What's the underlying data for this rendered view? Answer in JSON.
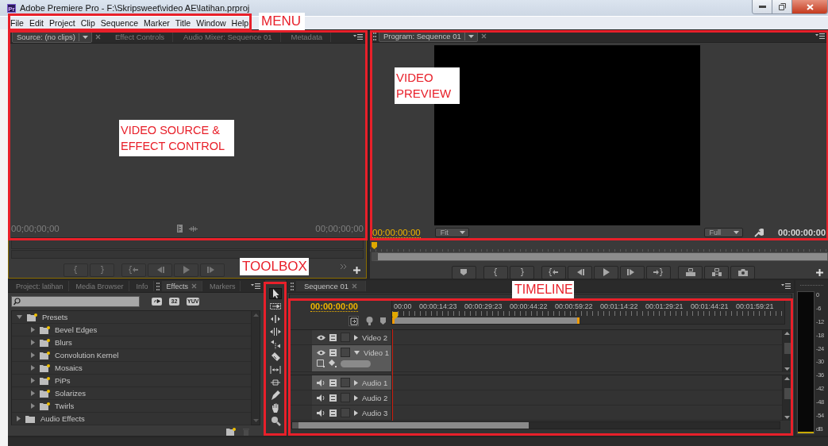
{
  "window": {
    "icon_text": "Pr",
    "title": "Adobe Premiere Pro - F:\\Skripsweet\\video AE\\latihan.prproj"
  },
  "menu": [
    "File",
    "Edit",
    "Project",
    "Clip",
    "Sequence",
    "Marker",
    "Title",
    "Window",
    "Help"
  ],
  "source_panel": {
    "tabs": [
      {
        "label": "Source: (no clips)",
        "selected": true
      },
      {
        "label": "Effect Controls",
        "selected": false
      },
      {
        "label": "Audio Mixer: Sequence 01",
        "selected": false
      },
      {
        "label": "Metadata",
        "selected": false
      }
    ],
    "timecode_left": "00;00;00;00",
    "timecode_right": "00;00;00;00"
  },
  "program_panel": {
    "tab": "Program: Sequence 01",
    "timecode": "00:00:00:00",
    "zoom": "Fit",
    "resolution": "Full",
    "duration": "00:00:00:00"
  },
  "project_panel": {
    "tabs": [
      {
        "label": "Project: latihan",
        "selected": false
      },
      {
        "label": "Media Browser",
        "selected": false
      },
      {
        "label": "Info",
        "selected": false
      },
      {
        "label": "Effects",
        "selected": true
      },
      {
        "label": "Markers",
        "selected": false
      }
    ],
    "filter_buttons": [
      "32",
      "YUV"
    ],
    "effects_tree": [
      {
        "label": "Presets",
        "kind": "preset",
        "expanded": true,
        "children": [
          {
            "label": "Bevel Edges",
            "kind": "preset",
            "expanded": false
          },
          {
            "label": "Blurs",
            "kind": "preset",
            "expanded": false
          },
          {
            "label": "Convolution Kernel",
            "kind": "preset",
            "expanded": false
          },
          {
            "label": "Mosaics",
            "kind": "preset",
            "expanded": false
          },
          {
            "label": "PiPs",
            "kind": "preset",
            "expanded": false
          },
          {
            "label": "Solarizes",
            "kind": "preset",
            "expanded": false
          },
          {
            "label": "Twirls",
            "kind": "preset",
            "expanded": false
          }
        ]
      },
      {
        "label": "Audio Effects",
        "kind": "folder",
        "expanded": false
      }
    ]
  },
  "toolbox": {
    "tools": [
      {
        "kind": "selection",
        "selected": true
      },
      {
        "kind": "track-select",
        "selected": false
      },
      {
        "kind": "ripple",
        "selected": false
      },
      {
        "kind": "rolling",
        "selected": false
      },
      {
        "kind": "rate-stretch",
        "selected": false
      },
      {
        "kind": "razor",
        "selected": false
      },
      {
        "kind": "slip",
        "selected": false
      },
      {
        "kind": "slide",
        "selected": false
      },
      {
        "kind": "pen",
        "selected": false
      },
      {
        "kind": "hand",
        "selected": false
      },
      {
        "kind": "zoom",
        "selected": false
      }
    ]
  },
  "timeline": {
    "tab": "Sequence 01",
    "timecode": "00:00:00:00",
    "ruler": [
      "00:00",
      "00:00:14:23",
      "00:00:29:23",
      "00:00:44:22",
      "00:00:59:22",
      "00:01:14:22",
      "00:01:29:21",
      "00:01:44:21",
      "00:01:59:21"
    ],
    "tracks": [
      {
        "name": "Video 2",
        "kind": "video",
        "expanded": false,
        "targeted": false
      },
      {
        "name": "Video 1",
        "kind": "video",
        "expanded": true,
        "targeted": true
      },
      {
        "name": "Audio 1",
        "kind": "audio",
        "expanded": false,
        "targeted": true
      },
      {
        "name": "Audio 2",
        "kind": "audio",
        "expanded": false,
        "targeted": false
      },
      {
        "name": "Audio 3",
        "kind": "audio",
        "expanded": false,
        "targeted": false
      }
    ]
  },
  "audio_meter": {
    "scale": [
      "0",
      "-6",
      "-12",
      "-18",
      "-24",
      "-30",
      "-36",
      "-42",
      "-48",
      "-54",
      "dB"
    ]
  },
  "annotations": [
    {
      "label": "MENU",
      "kind": "menu"
    },
    {
      "label": "VIDEO SOURCE & EFFECT CONTROL",
      "kind": "source"
    },
    {
      "label": "VIDEO PREVIEW",
      "kind": "program"
    },
    {
      "label": "TOOLBOX",
      "kind": "toolbox"
    },
    {
      "label": "TIMELINE",
      "kind": "timeline"
    }
  ]
}
